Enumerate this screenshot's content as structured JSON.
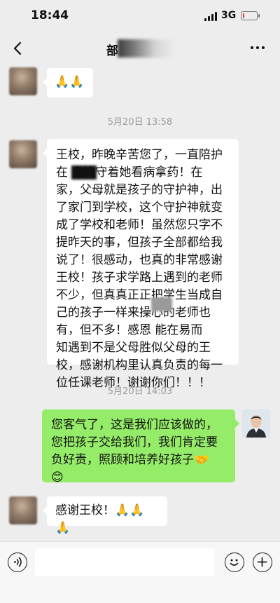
{
  "status_bar": {
    "time": "18:44",
    "network": "3G"
  },
  "header": {
    "title": "部"
  },
  "messages": [
    {
      "type": "incoming",
      "text": "🙏🙏"
    },
    {
      "type": "timestamp",
      "text": "5月20日 13:58"
    },
    {
      "type": "incoming",
      "text": "王校，昨晚辛苦您了，一直陪护\n在      身边守着她看病拿药！在\n家，父母就是孩子的守护神，出\n了家门到学校，这个守护神就变\n成了学校和老师！虽然您只字不\n提昨天的事，但孩子全部都给我\n说了！很感动，也真的非常感谢\n王校！孩子求学路上遇到的老师\n不少，但真真正正把学生当成自\n己的孩子一样来操心的老师也\n有，但不多！感恩      能在易而\n知遇到不是父母胜似父母的王\n校，感谢机构里认真负责的每一\n位任课老师！谢谢你们！！！"
    },
    {
      "type": "timestamp",
      "text": "5月20日 14:03"
    },
    {
      "type": "outgoing",
      "text": "您客气了，这是我们应该做的，\n您把孩子交给我们，我们肯定要\n负好责，照顾和培养好孩子🤝\n😊"
    },
    {
      "type": "incoming",
      "text": "感谢王校！🙏🙏🙏"
    }
  ],
  "input_bar": {
    "placeholder": ""
  },
  "icons": {
    "back": "chevron-left-icon",
    "more": "more-dots-icon",
    "voice": "voice-icon",
    "emoji": "emoji-icon",
    "add": "add-icon"
  },
  "colors": {
    "background": "#ededed",
    "incoming_bubble": "#ffffff",
    "outgoing_bubble": "#95ec69",
    "battery_level": "#e53935"
  },
  "battery_level": 0.15
}
